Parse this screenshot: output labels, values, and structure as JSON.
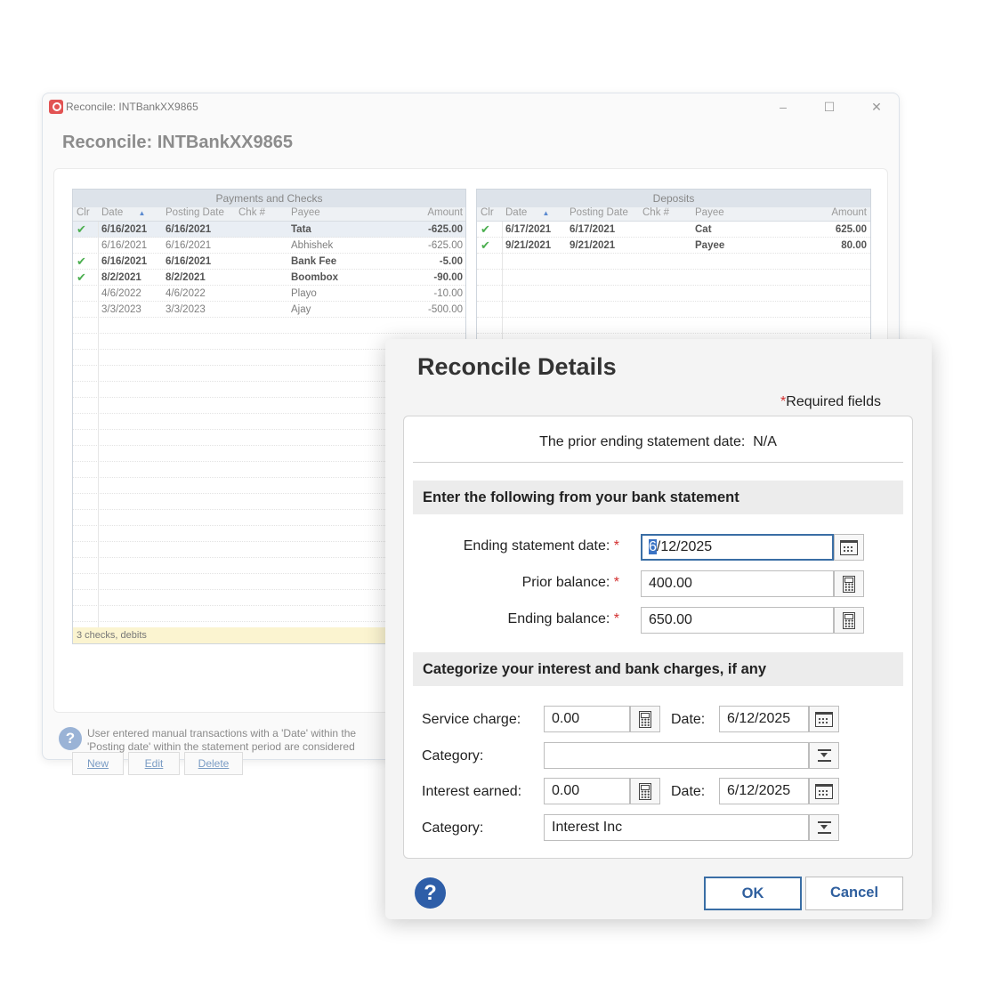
{
  "window": {
    "title": "Reconcile: INTBankXX9865",
    "heading": "Reconcile: INTBankXX9865",
    "minimize_glyph": "–",
    "maximize_glyph": "☐",
    "close_glyph": "✕"
  },
  "payments": {
    "title": "Payments and Checks",
    "columns": [
      "Clr",
      "Date",
      "Posting Date",
      "Chk #",
      "Payee",
      "Amount"
    ],
    "rows": [
      {
        "clr": "✔",
        "date": "6/16/2021",
        "posting": "6/16/2021",
        "chk": "",
        "payee": "Tata",
        "amount": "-625.00",
        "cleared": true
      },
      {
        "clr": "",
        "date": "6/16/2021",
        "posting": "6/16/2021",
        "chk": "",
        "payee": "Abhishek",
        "amount": "-625.00",
        "cleared": false
      },
      {
        "clr": "✔",
        "date": "6/16/2021",
        "posting": "6/16/2021",
        "chk": "",
        "payee": "Bank Fee",
        "amount": "-5.00",
        "cleared": true
      },
      {
        "clr": "✔",
        "date": "8/2/2021",
        "posting": "8/2/2021",
        "chk": "",
        "payee": "Boombox",
        "amount": "-90.00",
        "cleared": true
      },
      {
        "clr": "",
        "date": "4/6/2022",
        "posting": "4/6/2022",
        "chk": "",
        "payee": "Playo",
        "amount": "-10.00",
        "cleared": false
      },
      {
        "clr": "",
        "date": "3/3/2023",
        "posting": "3/3/2023",
        "chk": "",
        "payee": "Ajay",
        "amount": "-500.00",
        "cleared": false
      }
    ],
    "summary": "3 checks, debits"
  },
  "deposits": {
    "title": "Deposits",
    "columns": [
      "Clr",
      "Date",
      "Posting Date",
      "Chk #",
      "Payee",
      "Amount"
    ],
    "rows": [
      {
        "clr": "✔",
        "date": "6/17/2021",
        "posting": "6/17/2021",
        "chk": "",
        "payee": "Cat",
        "amount": "625.00"
      },
      {
        "clr": "✔",
        "date": "9/21/2021",
        "posting": "9/21/2021",
        "chk": "",
        "payee": "Payee",
        "amount": "80.00"
      }
    ]
  },
  "bottom_buttons": {
    "new": "New",
    "edit": "Edit",
    "delete": "Delete"
  },
  "help_note": {
    "glyph": "?",
    "line1": "User entered manual transactions with a 'Date' within the",
    "line2": "'Posting date' within the statement period are considered"
  },
  "dialog": {
    "title": "Reconcile Details",
    "required_star": "*",
    "required_label": "Required fields",
    "prior_label": "The prior ending statement date:",
    "prior_value": "N/A",
    "section1": "Enter the following from your bank statement",
    "ending_date_label": "Ending statement date:",
    "ending_date_first": "6",
    "ending_date_rest": "/12/2025",
    "prior_balance_label": "Prior balance:",
    "prior_balance_value": "400.00",
    "ending_balance_label": "Ending balance:",
    "ending_balance_value": "650.00",
    "section2": "Categorize your interest and bank charges, if any",
    "service_charge_label": "Service charge:",
    "service_charge_value": "0.00",
    "service_date_label": "Date:",
    "service_date_value": "6/12/2025",
    "category_label": "Category:",
    "service_category_value": "",
    "interest_label": "Interest earned:",
    "interest_value": "0.00",
    "interest_date_label": "Date:",
    "interest_date_value": "6/12/2025",
    "interest_category_value": "Interest Inc",
    "help_glyph": "?",
    "ok": "OK",
    "cancel": "Cancel"
  }
}
